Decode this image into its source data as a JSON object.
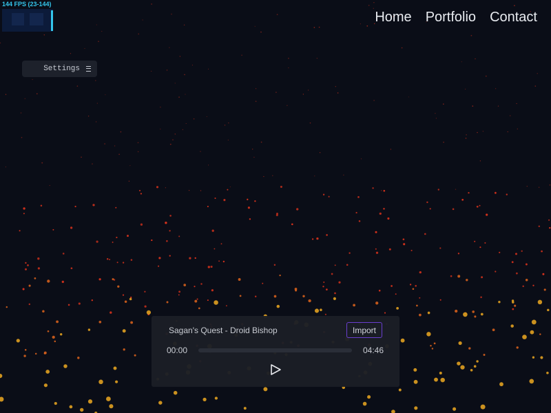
{
  "fps": {
    "label": "144 FPS (23-144)"
  },
  "nav": {
    "items": [
      "Home",
      "Portfolio",
      "Contact"
    ]
  },
  "settings": {
    "label": "Settings",
    "icon": "hamburger-icon"
  },
  "player": {
    "track_title": "Sagan's Quest - Droid Bishop",
    "import_label": "Import",
    "time_current": "00:00",
    "time_total": "04:46",
    "progress": 0,
    "play_icon": "play-icon",
    "accent_color": "#6a3fd0"
  },
  "colors": {
    "background": "#0a0d17",
    "particle_red": "#d6321c",
    "particle_orange": "#e0651c",
    "particle_gold": "#e0a020",
    "fps_cyan": "#34c6ec"
  }
}
